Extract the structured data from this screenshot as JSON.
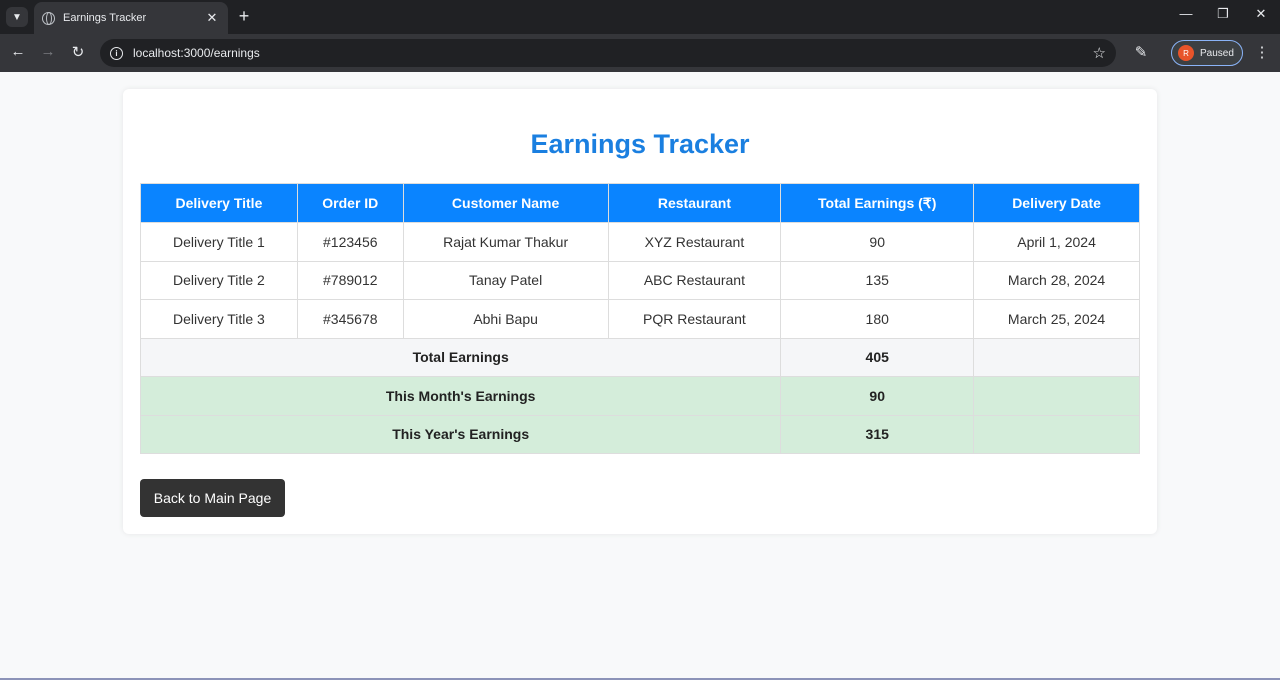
{
  "browser": {
    "tab_title": "Earnings Tracker",
    "url": "localhost:3000/earnings",
    "profile_initial": "R",
    "profile_status": "Paused"
  },
  "page": {
    "title": "Earnings Tracker",
    "table": {
      "headers": [
        "Delivery Title",
        "Order ID",
        "Customer Name",
        "Restaurant",
        "Total Earnings (₹)",
        "Delivery Date"
      ],
      "rows": [
        [
          "Delivery Title 1",
          "#123456",
          "Rajat Kumar Thakur",
          "XYZ Restaurant",
          "90",
          "April 1, 2024"
        ],
        [
          "Delivery Title 2",
          "#789012",
          "Tanay Patel",
          "ABC Restaurant",
          "135",
          "March 28, 2024"
        ],
        [
          "Delivery Title 3",
          "#345678",
          "Abhi Bapu",
          "PQR Restaurant",
          "180",
          "March 25, 2024"
        ]
      ],
      "summary": [
        {
          "label": "Total Earnings",
          "value": "405"
        },
        {
          "label": "This Month's Earnings",
          "value": "90"
        },
        {
          "label": "This Year's Earnings",
          "value": "315"
        }
      ]
    },
    "back_button": "Back to Main Page"
  },
  "colors": {
    "header_blue": "#0a84ff",
    "title_blue": "#1a7fe0",
    "summary_green": "#d4edda"
  }
}
